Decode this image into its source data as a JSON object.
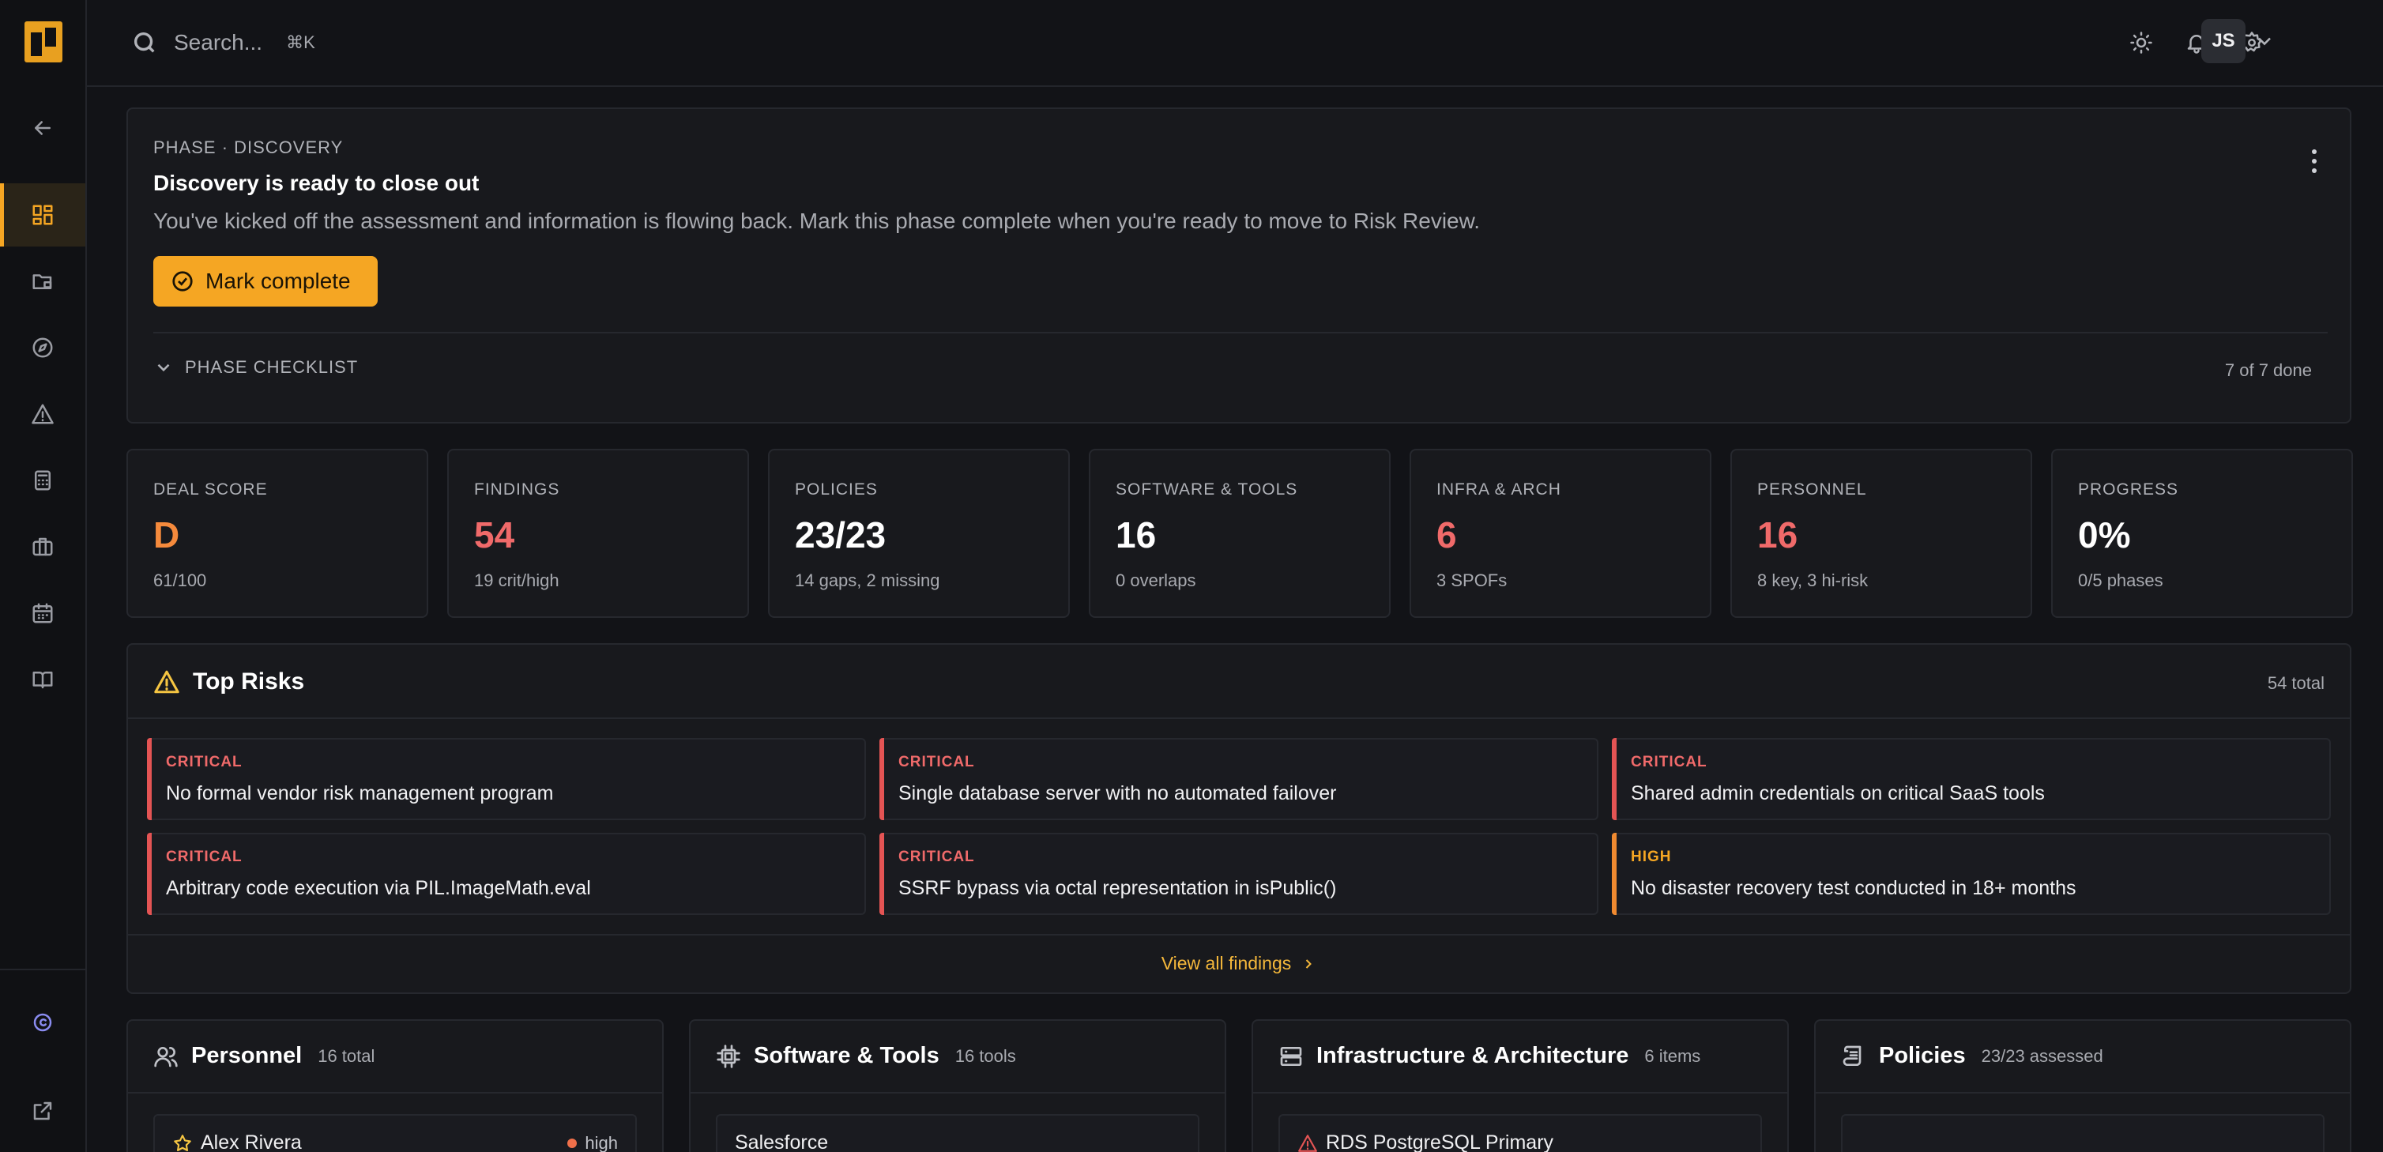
{
  "topbar": {
    "search_placeholder": "Search...",
    "search_shortcut": "⌘K",
    "avatar_initials": "JS"
  },
  "phase": {
    "label": "PHASE · DISCOVERY",
    "title": "Discovery is ready to close out",
    "description": "You've kicked off the assessment and information is flowing back. Mark this phase complete when you're ready to move to Risk Review.",
    "button_label": "Mark complete",
    "checklist_label": "PHASE CHECKLIST",
    "checklist_count": "7 of 7 done"
  },
  "stats": [
    {
      "label": "DEAL SCORE",
      "value": "D",
      "sub": "61/100",
      "tone": "orange"
    },
    {
      "label": "FINDINGS",
      "value": "54",
      "sub": "19 crit/high",
      "tone": "red"
    },
    {
      "label": "POLICIES",
      "value": "23/23",
      "sub": "14 gaps, 2 missing",
      "tone": "normal"
    },
    {
      "label": "SOFTWARE & TOOLS",
      "value": "16",
      "sub": "0 overlaps",
      "tone": "normal"
    },
    {
      "label": "INFRA & ARCH",
      "value": "6",
      "sub": "3 SPOFs",
      "tone": "red"
    },
    {
      "label": "PERSONNEL",
      "value": "16",
      "sub": "8 key, 3 hi-risk",
      "tone": "red"
    },
    {
      "label": "PROGRESS",
      "value": "0%",
      "sub": "0/5 phases",
      "tone": "normal"
    }
  ],
  "risks": {
    "title": "Top Risks",
    "total": "54 total",
    "items": [
      {
        "severity": "CRITICAL",
        "title": "No formal vendor risk management program"
      },
      {
        "severity": "CRITICAL",
        "title": "Single database server with no automated failover"
      },
      {
        "severity": "CRITICAL",
        "title": "Shared admin credentials on critical SaaS tools"
      },
      {
        "severity": "CRITICAL",
        "title": "Arbitrary code execution via PIL.ImageMath.eval"
      },
      {
        "severity": "CRITICAL",
        "title": "SSRF bypass via octal representation in isPublic()"
      },
      {
        "severity": "HIGH",
        "title": "No disaster recovery test conducted in 18+ months"
      }
    ],
    "view_all": "View all findings"
  },
  "bottom_cards": {
    "personnel": {
      "title": "Personnel",
      "count": "16 total",
      "first_item": "Alex Rivera",
      "first_item_badge": "high"
    },
    "software": {
      "title": "Software & Tools",
      "count": "16 tools",
      "first_item": "Salesforce"
    },
    "infra": {
      "title": "Infrastructure & Architecture",
      "count": "6 items",
      "first_item": "RDS PostgreSQL Primary"
    },
    "policies": {
      "title": "Policies",
      "count": "23/23 assessed"
    }
  },
  "colors": {
    "accent": "#f5a623",
    "critical": "#e45454",
    "high": "#f08a30"
  }
}
